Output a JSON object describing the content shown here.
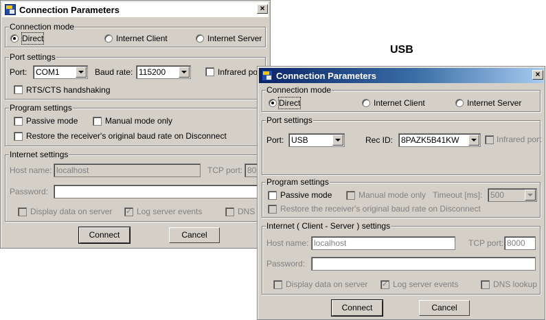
{
  "dialog1": {
    "title": "Connection Parameters",
    "close": "×",
    "connection_mode": {
      "legend": "Connection mode",
      "direct": "Direct",
      "client": "Internet Client",
      "server": "Internet Server"
    },
    "port_settings": {
      "legend": "Port settings",
      "port_label": "Port:",
      "port_value": "COM1",
      "baud_label": "Baud rate:",
      "baud_value": "115200",
      "infrared": "Infrared po",
      "rts": "RTS/CTS handshaking"
    },
    "program_settings": {
      "legend": "Program settings",
      "passive": "Passive mode",
      "manual": "Manual mode only",
      "restore": "Restore the receiver's original baud rate on Disconnect"
    },
    "internet_settings": {
      "legend": "Internet settings",
      "host_label": "Host name:",
      "host_value": "localhost",
      "tcp_label": "TCP port:",
      "tcp_value": "80",
      "password_label": "Password:",
      "display_data": "Display data on server",
      "log_events": "Log server events",
      "dns": "DNS"
    },
    "connect": "Connect",
    "cancel": "Cancel"
  },
  "usb_heading": "USB",
  "dialog2": {
    "title": "Connection Parameters",
    "close": "×",
    "connection_mode": {
      "legend": "Connection mode",
      "direct": "Direct",
      "client": "Internet Client",
      "server": "Internet Server"
    },
    "port_settings": {
      "legend": "Port settings",
      "port_label": "Port:",
      "port_value": "USB",
      "rec_label": "Rec ID:",
      "rec_value": "8PAZK5B41KW",
      "infrared": "Infrared port"
    },
    "program_settings": {
      "legend": "Program settings",
      "passive": "Passive mode",
      "manual": "Manual mode only",
      "timeout_label": "Timeout [ms]:",
      "timeout_value": "500",
      "restore": "Restore the receiver's original baud rate on Disconnect"
    },
    "internet_settings": {
      "legend": "Internet ( Client - Server ) settings",
      "host_label": "Host name:",
      "host_value": "localhost",
      "tcp_label": "TCP port:",
      "tcp_value": "8000",
      "password_label": "Password:",
      "display_data": "Display data on server",
      "log_events": "Log server events",
      "dns": "DNS lookup"
    },
    "connect": "Connect",
    "cancel": "Cancel"
  },
  "colors": {
    "dialog_face": "#d4d0c8",
    "title_active": "#0a246a",
    "title_gradient_end": "#a6caf0",
    "disabled_text": "#808080"
  }
}
